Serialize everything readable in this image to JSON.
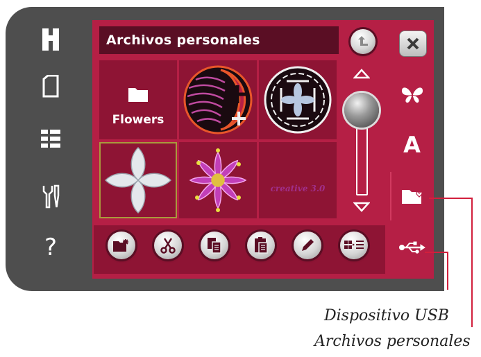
{
  "sidebar": {
    "items": [
      {
        "icon": "home-icon"
      },
      {
        "icon": "screen-icon"
      },
      {
        "icon": "list-icon"
      },
      {
        "icon": "tools-icon"
      },
      {
        "icon": "help-icon",
        "glyph": "?"
      }
    ]
  },
  "title": "Archivos personales",
  "grid": [
    {
      "type": "folder",
      "label": "Flowers"
    },
    {
      "type": "embroidery",
      "name": "moon-design"
    },
    {
      "type": "embroidery",
      "name": "circle-flower-design"
    },
    {
      "type": "embroidery",
      "name": "cross-flower-design",
      "selected": true
    },
    {
      "type": "embroidery",
      "name": "purple-flower-design"
    },
    {
      "type": "text-design",
      "label": "creative 3.0"
    }
  ],
  "toolbar": [
    {
      "icon": "new-folder-icon"
    },
    {
      "icon": "cut-icon"
    },
    {
      "icon": "copy-icon"
    },
    {
      "icon": "paste-icon"
    },
    {
      "icon": "rename-icon"
    },
    {
      "icon": "view-toggle-icon"
    }
  ],
  "tabs": [
    {
      "icon": "butterfly-icon"
    },
    {
      "icon": "font-icon",
      "glyph": "A"
    },
    {
      "icon": "personal-files-icon",
      "active": true
    },
    {
      "icon": "usb-icon"
    }
  ],
  "callouts": {
    "usb": "Dispositivo USB",
    "personal": "Archivos personales"
  },
  "colors": {
    "frame": "#4e4e4e",
    "screen": "#b51f45",
    "cell": "#8e1434",
    "title_bg": "#5a0e24",
    "callout_line": "#d21f3c"
  }
}
